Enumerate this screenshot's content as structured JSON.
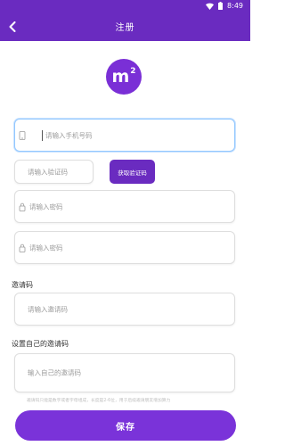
{
  "status_bar": {
    "time": "8:49",
    "wifi_icon": "wifi-icon",
    "battery_icon": "battery-icon"
  },
  "header": {
    "title": "注册",
    "back_icon": "chevron-left-icon"
  },
  "logo": {
    "text": "m",
    "superscript": "2"
  },
  "form": {
    "phone_placeholder": "请输入手机号码",
    "code_placeholder": "请输入验证码",
    "get_code_label": "获取验证码",
    "password_placeholder": "请输入密码",
    "confirm_password_placeholder": "请输入密码",
    "invite_label": "邀请码",
    "invite_placeholder": "请输入邀请码",
    "own_invite_label": "设置自己的邀请码",
    "own_invite_placeholder": "输入自己的邀请码",
    "hint": "邀请码只能是数字或者字母组成，长度是2-6位，用于后续邀请朋友增加算力"
  },
  "save_label": "保存",
  "colors": {
    "accent": "#6a2bc0",
    "button": "#7a33d9"
  }
}
